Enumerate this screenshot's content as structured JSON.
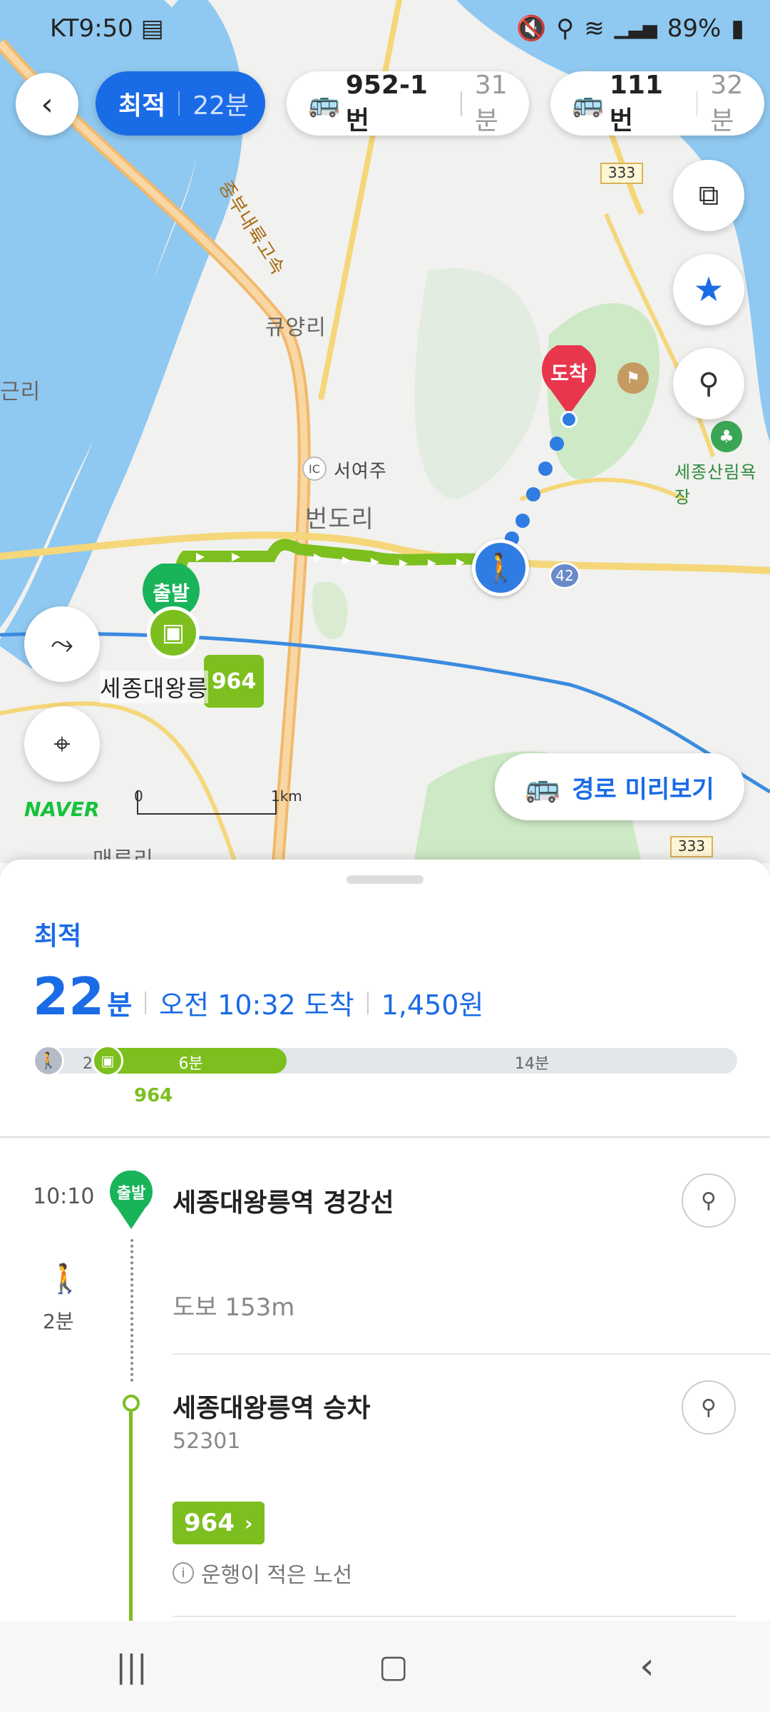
{
  "status_bar": {
    "carrier": "KT",
    "time": "9:50",
    "battery": "89%"
  },
  "route_tabs": [
    {
      "label": "최적",
      "duration": "22분",
      "active": true
    },
    {
      "label": "952-1번",
      "duration": "31분",
      "active": false
    },
    {
      "label": "111번",
      "duration": "32분",
      "active": false
    }
  ],
  "map": {
    "places": [
      "큐양리",
      "근리",
      "서여주",
      "번도리",
      "세종산림욕장",
      "매류리",
      "세종대왕릉"
    ],
    "road_label": "중부내륙고속",
    "ic_label": "IC",
    "route_shields": [
      "333",
      "42",
      "333"
    ],
    "markers": {
      "start": "출발",
      "end": "도착",
      "bus_no": "964"
    },
    "scale": {
      "zero": "0",
      "km": "1km"
    },
    "brand": "NAVER",
    "preview_button": "경로 미리보기"
  },
  "summary": {
    "type": "최적",
    "minutes": "22",
    "minutes_unit": "분",
    "arrival": "오전 10:32 도착",
    "fare": "1,450원",
    "bar": {
      "walk_label": "2분",
      "bus_label": "6분",
      "rest_label": "14분",
      "bus_no": "964",
      "walk_fraction": 0.09,
      "bus_fraction": 0.27
    }
  },
  "steps": {
    "start_time": "10:10",
    "start_badge": "출발",
    "start_title": "세종대왕릉역 경강선",
    "walk_icon_label": "2분",
    "walk_text": "도보 153m",
    "board_title": "세종대왕릉역 승차",
    "board_code": "52301",
    "bus_badge": "964",
    "notice": "운행이 적은 노선"
  },
  "colors": {
    "accent": "#1a6be6",
    "bus_green": "#7cbf1e",
    "marker_green": "#19b35a",
    "marker_red": "#e8364d"
  }
}
